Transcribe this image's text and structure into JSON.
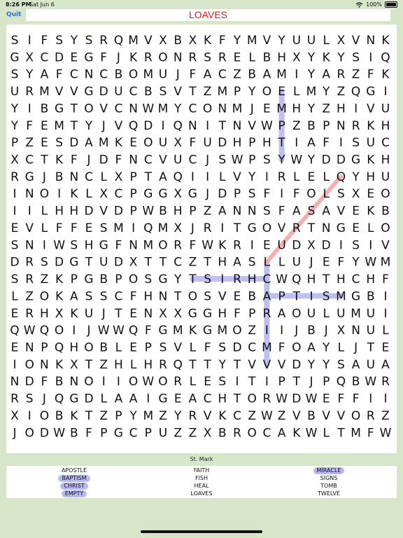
{
  "status": {
    "time": "8:26 PM",
    "date": "Sat Jun 6",
    "battery": "100%",
    "battery_level": 1.0
  },
  "toolbar": {
    "quit_label": "Quit",
    "title": "LOAVES",
    "title_color": "#e01b1b",
    "accent_color": "#2a6fd6"
  },
  "puzzle": {
    "rows": [
      "SIFSYSRQMVXBXKFYMVYUULXVNK",
      "GXCDEGFJKRONRSRELBHXYKYSIQ",
      "SYAFCNCBOMUJFACZBAMIYARZFK",
      "URMVVGDUCBSVTZMPYOELMYZQGI",
      "YIBGTOVCNWMYCONMJEMHYZHIVU",
      "YFEMTYJVQDIQNITNVWPZBPNRKH",
      "PZESDAMKEOUXFUDHPHTIAFISUC",
      "XCTKFJDFNCVUCJSWPSYWYDDGKH",
      "RGJBNCLXPTAQIILVYIRLELQYHU",
      "INOIKLXCPGGXGJDPSFIFOLSXEO",
      "IILHHDVDPWBHPZANNSFASAVEKB",
      "EVLFFESMIQMXJRITGOVRTNGELO",
      "SNIWSHGFNMORFWKRIEUDXDISIV",
      "DRSDGTUDXTTCZTHASLLUJEFYWM",
      "SRZKPGBPOSGYTSIRHCWQHTHCHF",
      "LZOKASSCFHNTOSVEBAPTISMGBI",
      "ERHXKUJTENXXGGHFPRAOULUMUI",
      "QWQOIJWWQFGMKGMOZIIJBJXNUL",
      "ENPQHOBLEPSVLFSDCMFOAYLJTE",
      "IONKXTZHLHRQTTYTVVVDYYSAUA",
      "NDFBNOIIOWORLESITIPTJPQBWR",
      "RSJQGDLAAIGEACHTORWDWEFFII",
      "XIOBKTZPYMZYRVKCZWZVBVVORZ",
      "JODWBFPGCPUZZXBROCAKWLTMFW"
    ],
    "found_highlight_color": "#b9b9f2",
    "current_highlight_color": "#f2a8a8"
  },
  "word_list": {
    "header": "St. Mark",
    "words": [
      {
        "text": "APOSTLE",
        "found": false
      },
      {
        "text": "BAPTISM",
        "found": true
      },
      {
        "text": "CHRIST",
        "found": true
      },
      {
        "text": "EMPTY",
        "found": true
      },
      {
        "text": "FAITH",
        "found": false
      },
      {
        "text": "FISH",
        "found": false
      },
      {
        "text": "HEAL",
        "found": false
      },
      {
        "text": "LOAVES",
        "found": false
      },
      {
        "text": "MIRACLE",
        "found": true
      },
      {
        "text": "SIGNS",
        "found": false
      },
      {
        "text": "TOMB",
        "found": false
      },
      {
        "text": "TWELVE",
        "found": false
      }
    ]
  }
}
